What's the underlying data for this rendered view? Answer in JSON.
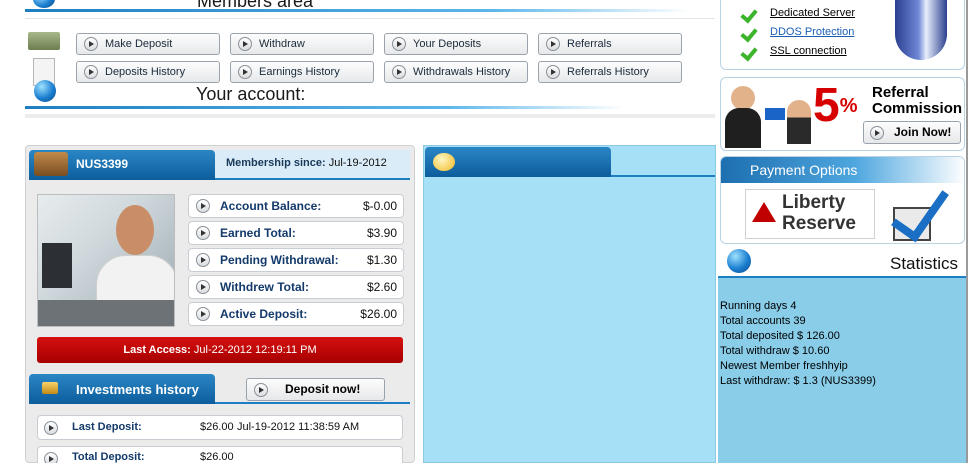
{
  "header": {
    "members_area_title": "Members area",
    "your_account_title": "Your account:"
  },
  "nav": {
    "make_deposit": "Make Deposit",
    "withdraw": "Withdraw",
    "your_deposits": "Your Deposits",
    "referrals": "Referrals",
    "deposits_history": "Deposits History",
    "earnings_history": "Earnings History",
    "withdrawals_history": "Withdrawals History",
    "referrals_history": "Referrals History"
  },
  "account": {
    "username": "NUS3399",
    "membership_label": "Membership since:",
    "membership_date": "Jul-19-2012",
    "rows": [
      {
        "label": "Account Balance:",
        "value": "$-0.00"
      },
      {
        "label": "Earned Total:",
        "value": "$3.90"
      },
      {
        "label": "Pending Withdrawal:",
        "value": "$1.30"
      },
      {
        "label": "Withdrew Total:",
        "value": "$2.60"
      },
      {
        "label": "Active Deposit:",
        "value": "$26.00"
      }
    ],
    "last_access_label": "Last Access:",
    "last_access_value": "Jul-22-2012 12:19:11 PM"
  },
  "investments": {
    "title": "Investments history",
    "deposit_now": "Deposit now!",
    "last_deposit_label": "Last Deposit:",
    "last_deposit_amount": "$26.00",
    "last_deposit_date": "Jul-19-2012 11:38:59 AM",
    "total_deposit_label": "Total Deposit:",
    "total_deposit_amount": "$26.00"
  },
  "sidebar": {
    "features": [
      "Dedicated Server",
      "DDOS Protection",
      "SSL connection"
    ],
    "referral_percent": "5",
    "referral_percent_sign": "%",
    "referral_line1": "Referral",
    "referral_line2": "Commission",
    "join_now": "Join Now!",
    "payment_options_title": "Payment Options",
    "liberty_line1": "Liberty",
    "liberty_line2": "Reserve",
    "statistics_title": "Statistics",
    "stats": [
      "Running days 4",
      "Total accounts 39",
      "Total deposited $ 126.00",
      "Total withdraw $ 10.60",
      "Newest Member freshhyip",
      "Last withdraw: $ 1.3 (NUS3399)"
    ]
  },
  "colors": {
    "accent_blue": "#1d7fc1",
    "panel_light_blue": "#a6e0f7",
    "stats_bg": "#89cde9",
    "last_access_red": "#c40000"
  }
}
